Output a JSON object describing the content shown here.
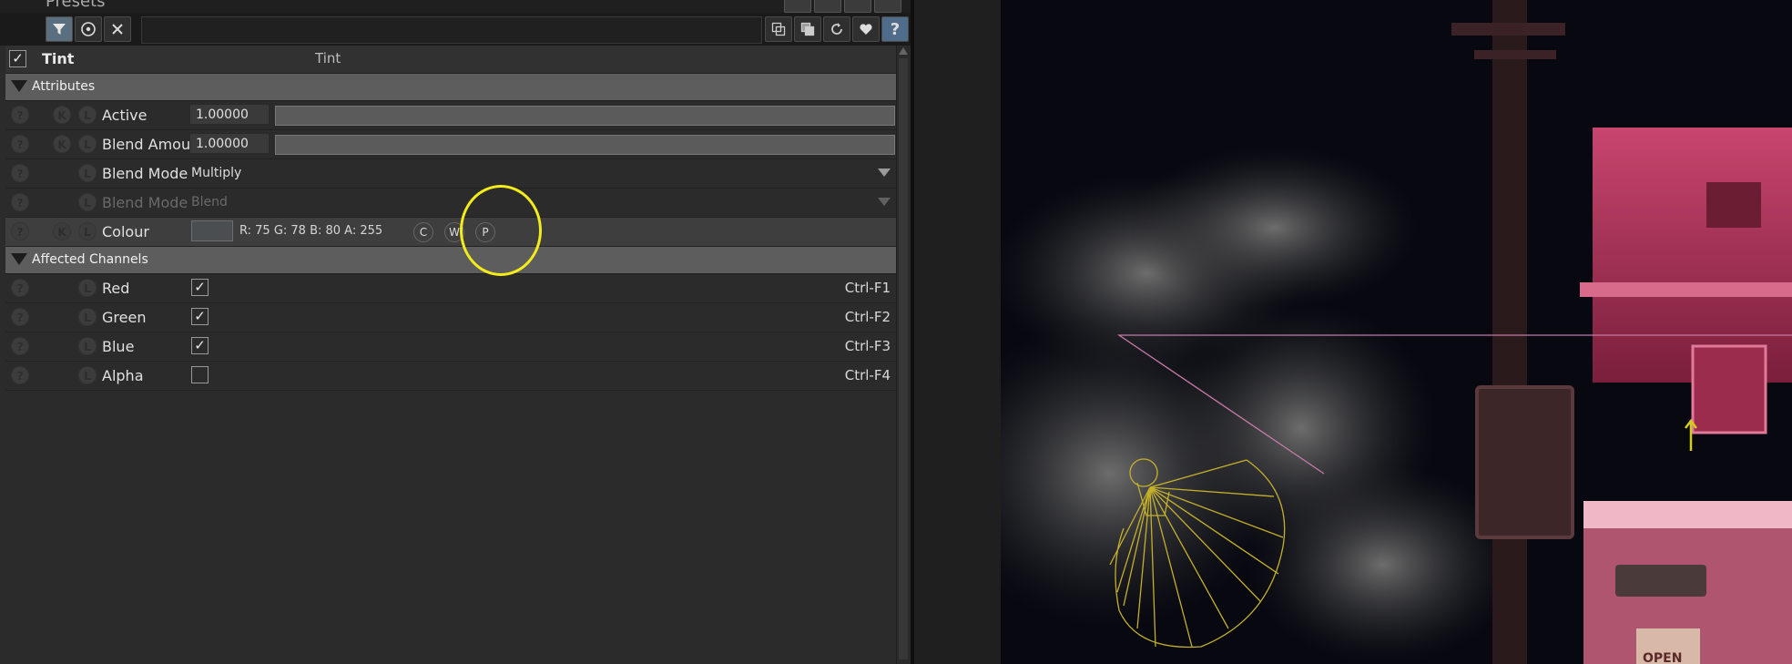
{
  "presets": {
    "title": "Presets"
  },
  "toolbar": {
    "left_icons": [
      "filter-icon",
      "target-icon",
      "close-icon"
    ],
    "right_icons": [
      "copy-icon",
      "paste-icon",
      "refresh-icon",
      "heart-icon",
      "help-icon"
    ],
    "help_glyph": "?"
  },
  "header": {
    "checked": true,
    "name": "Tint",
    "value": "Tint"
  },
  "attributes": {
    "title": "Attributes",
    "active": {
      "label": "Active",
      "value": "1.00000"
    },
    "blend_amount": {
      "label": "Blend Amour",
      "value": "1.00000"
    },
    "blend_mode_color": {
      "label": "Blend Mode (",
      "value": "Multiply"
    },
    "blend_mode_alpha": {
      "label": "Blend Mode (",
      "value": "Blend"
    },
    "colour": {
      "label": "Colour",
      "swatch": "#4b4e50",
      "rgba": "R: 75 G: 78 B: 80 A: 255",
      "btn_c": "C",
      "btn_w": "W",
      "btn_p": "P"
    }
  },
  "channels": {
    "title": "Affected Channels",
    "red": {
      "label": "Red",
      "checked": true,
      "shortcut": "Ctrl-F1"
    },
    "green": {
      "label": "Green",
      "checked": true,
      "shortcut": "Ctrl-F2"
    },
    "blue": {
      "label": "Blue",
      "checked": true,
      "shortcut": "Ctrl-F3"
    },
    "alpha": {
      "label": "Alpha",
      "checked": false,
      "shortcut": "Ctrl-F4"
    }
  },
  "glyphs": {
    "check": "✓",
    "help": "?",
    "k": "K",
    "l": "L"
  },
  "viewport": {
    "sign_text": "OPEN"
  }
}
